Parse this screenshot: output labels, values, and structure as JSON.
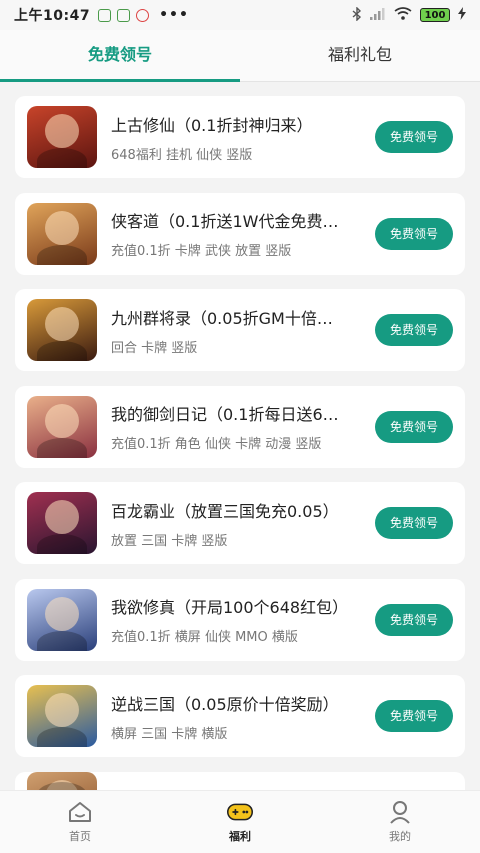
{
  "statusbar": {
    "time": "上午10:47",
    "dots": "•••",
    "battery": "100"
  },
  "tabs": [
    {
      "label": "免费领号",
      "active": true
    },
    {
      "label": "福利礼包",
      "active": false
    }
  ],
  "games": [
    {
      "title": "上古修仙（0.1折封神归来）",
      "tags": "648福利 挂机 仙侠 竖版",
      "button": "免费领号",
      "thumb_colors": [
        "#5b1410",
        "#c8442a"
      ]
    },
    {
      "title": "侠客道（0.1折送1W代金免费…",
      "tags": "充值0.1折 卡牌 武侠 放置 竖版",
      "button": "免费领号",
      "thumb_colors": [
        "#7a3a1a",
        "#e0a45a"
      ]
    },
    {
      "title": "九州群将录（0.05折GM十倍…",
      "tags": "回合 卡牌 竖版",
      "button": "免费领号",
      "thumb_colors": [
        "#3a1a10",
        "#d89a3a"
      ]
    },
    {
      "title": "我的御剑日记（0.1折每日送6…",
      "tags": "充值0.1折 角色 仙侠 卡牌 动漫 竖版",
      "button": "免费领号",
      "thumb_colors": [
        "#8a3040",
        "#e9b08a"
      ]
    },
    {
      "title": "百龙霸业（放置三国免充0.05）",
      "tags": "放置 三国 卡牌 竖版",
      "button": "免费领号",
      "thumb_colors": [
        "#2a1530",
        "#a03050"
      ]
    },
    {
      "title": "我欲修真（开局100个648红包）",
      "tags": "充值0.1折 横屏 仙侠 MMO 横版",
      "button": "免费领号",
      "thumb_colors": [
        "#2a3f7a",
        "#b9c8ee"
      ]
    },
    {
      "title": "逆战三国（0.05原价十倍奖励）",
      "tags": "横屏 三国 卡牌 横版",
      "button": "免费领号",
      "thumb_colors": [
        "#2a5aa0",
        "#e8c050"
      ]
    }
  ],
  "partial_thumb_colors": [
    "#a06a40",
    "#d0a070"
  ],
  "nav": [
    {
      "label": "首页",
      "icon": "home-icon",
      "active": false
    },
    {
      "label": "福利",
      "icon": "gamepad-icon",
      "active": true
    },
    {
      "label": "我的",
      "icon": "person-icon",
      "active": false
    }
  ],
  "colors": {
    "accent": "#169b82",
    "gamepad_yellow": "#f3c21b"
  }
}
